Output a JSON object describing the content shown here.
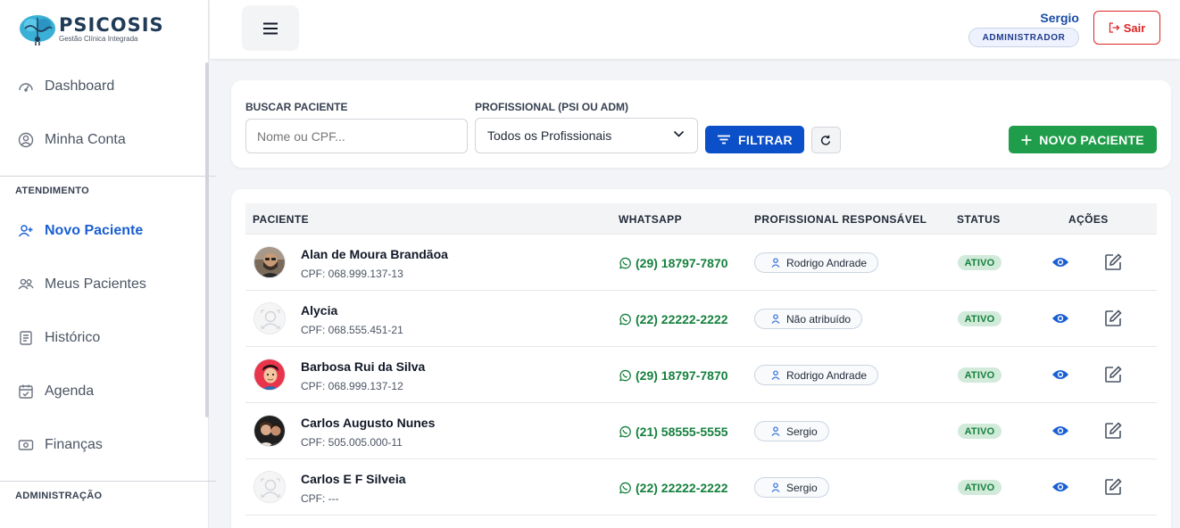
{
  "brand": {
    "name": "PSICOSIS",
    "tagline": "Gestão Clínica Integrada"
  },
  "sidebar": {
    "items_top": [
      {
        "label": "Dashboard",
        "icon": "gauge-icon"
      },
      {
        "label": "Minha Conta",
        "icon": "user-circle-icon"
      }
    ],
    "section_atendimento": "ATENDIMENTO",
    "items_atendimento": [
      {
        "label": "Novo Paciente",
        "icon": "user-plus-icon",
        "active": true
      },
      {
        "label": "Meus Pacientes",
        "icon": "users-icon"
      },
      {
        "label": "Histórico",
        "icon": "document-list-icon"
      },
      {
        "label": "Agenda",
        "icon": "calendar-check-icon"
      },
      {
        "label": "Finanças",
        "icon": "money-icon"
      }
    ],
    "section_administracao": "ADMINISTRAÇÃO"
  },
  "header": {
    "user_name": "Sergio",
    "role": "ADMINISTRADOR",
    "logout_label": "Sair"
  },
  "filters": {
    "search_label": "BUSCAR PACIENTE",
    "search_placeholder": "Nome ou CPF...",
    "professional_label": "PROFISSIONAL (PSI OU ADM)",
    "professional_selected": "Todos os Profissionais",
    "filter_button": "FILTRAR",
    "new_patient_button": "NOVO PACIENTE"
  },
  "table": {
    "columns": {
      "patient": "PACIENTE",
      "whatsapp": "WHATSAPP",
      "professional": "PROFISSIONAL RESPONSÁVEL",
      "status": "STATUS",
      "actions": "AÇÕES"
    },
    "rows": [
      {
        "name": "Alan de Moura Brandãoa",
        "cpf": "CPF: 068.999.137-13",
        "whatsapp": "(29) 18797-7870",
        "professional": "Rodrigo Andrade",
        "status": "ATIVO",
        "avatar": "photo-man-beard"
      },
      {
        "name": "Alycia",
        "cpf": "CPF: 068.555.451-21",
        "whatsapp": "(22) 22222-2222",
        "professional": "Não atribuído",
        "status": "ATIVO",
        "avatar": "placeholder"
      },
      {
        "name": "Barbosa Rui da Silva",
        "cpf": "CPF: 068.999.137-12",
        "whatsapp": "(29) 18797-7870",
        "professional": "Rodrigo Andrade",
        "status": "ATIVO",
        "avatar": "cartoon-red"
      },
      {
        "name": "Carlos Augusto Nunes",
        "cpf": "CPF: 505.005.000-11",
        "whatsapp": "(21) 58555-5555",
        "professional": "Sergio",
        "status": "ATIVO",
        "avatar": "photo-couple"
      },
      {
        "name": "Carlos E F Silveia",
        "cpf": "CPF: ---",
        "whatsapp": "(22) 22222-2222",
        "professional": "Sergio",
        "status": "ATIVO",
        "avatar": "placeholder"
      }
    ]
  },
  "colors": {
    "primary": "#0b4fc9",
    "success": "#1f9d4a",
    "danger": "#dc2626",
    "active_nav": "#1a5fd1"
  }
}
